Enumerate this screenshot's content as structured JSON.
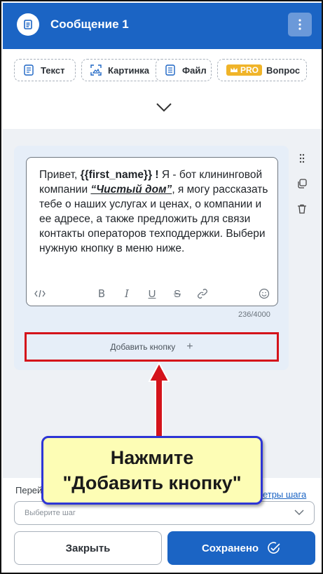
{
  "header": {
    "title": "Сообщение 1",
    "icon": "document-icon",
    "menu_icon": "kebab-menu-icon",
    "color": "#1b64c4"
  },
  "chips": [
    {
      "label": "Текст",
      "icon": "text-doc-icon"
    },
    {
      "label": "Картинка",
      "icon": "image-scan-icon"
    },
    {
      "label": "Файл",
      "icon": "file-icon"
    },
    {
      "label": "Вопрос",
      "icon": "crown-icon",
      "badge": "PRO"
    }
  ],
  "editor": {
    "line1_pre": "Привет, ",
    "var_name": "{{first_name}}",
    "line1_mid": " ! ",
    "line1_post": "Я - бот клининговой компании ",
    "company": "“Чистый дом”",
    "rest": ", я могу рассказать тебе о наших услугах и ценах, о компании и ее адресе, а также предложить для связи контакты операторов техподдержки. Выбери нужную кнопку в меню ниже.",
    "toolbar": [
      "code-icon",
      "bold-icon",
      "italic-icon",
      "underline-icon",
      "strikethrough-icon",
      "link-icon",
      "emoji-icon"
    ],
    "toolbar_glyphs": {
      "bold": "B",
      "italic": "I",
      "underline": "U",
      "strike": "S"
    },
    "counter": "236/4000"
  },
  "add_button": {
    "label": "Добавить кнопку",
    "plus": "+"
  },
  "callout": {
    "line1": "Нажмите",
    "line2": "\"Добавить кнопку\""
  },
  "footer": {
    "step_label": "Перей",
    "step_link": "метры шага",
    "select_placeholder": "Выберите шаг",
    "close_label": "Закрыть",
    "save_label": "Сохранено"
  },
  "colors": {
    "accent": "#1b64c4",
    "highlight_border": "#d4131b",
    "callout_bg": "#fdfdb5",
    "callout_border": "#2d35d6",
    "pro_badge": "#f0b429"
  }
}
